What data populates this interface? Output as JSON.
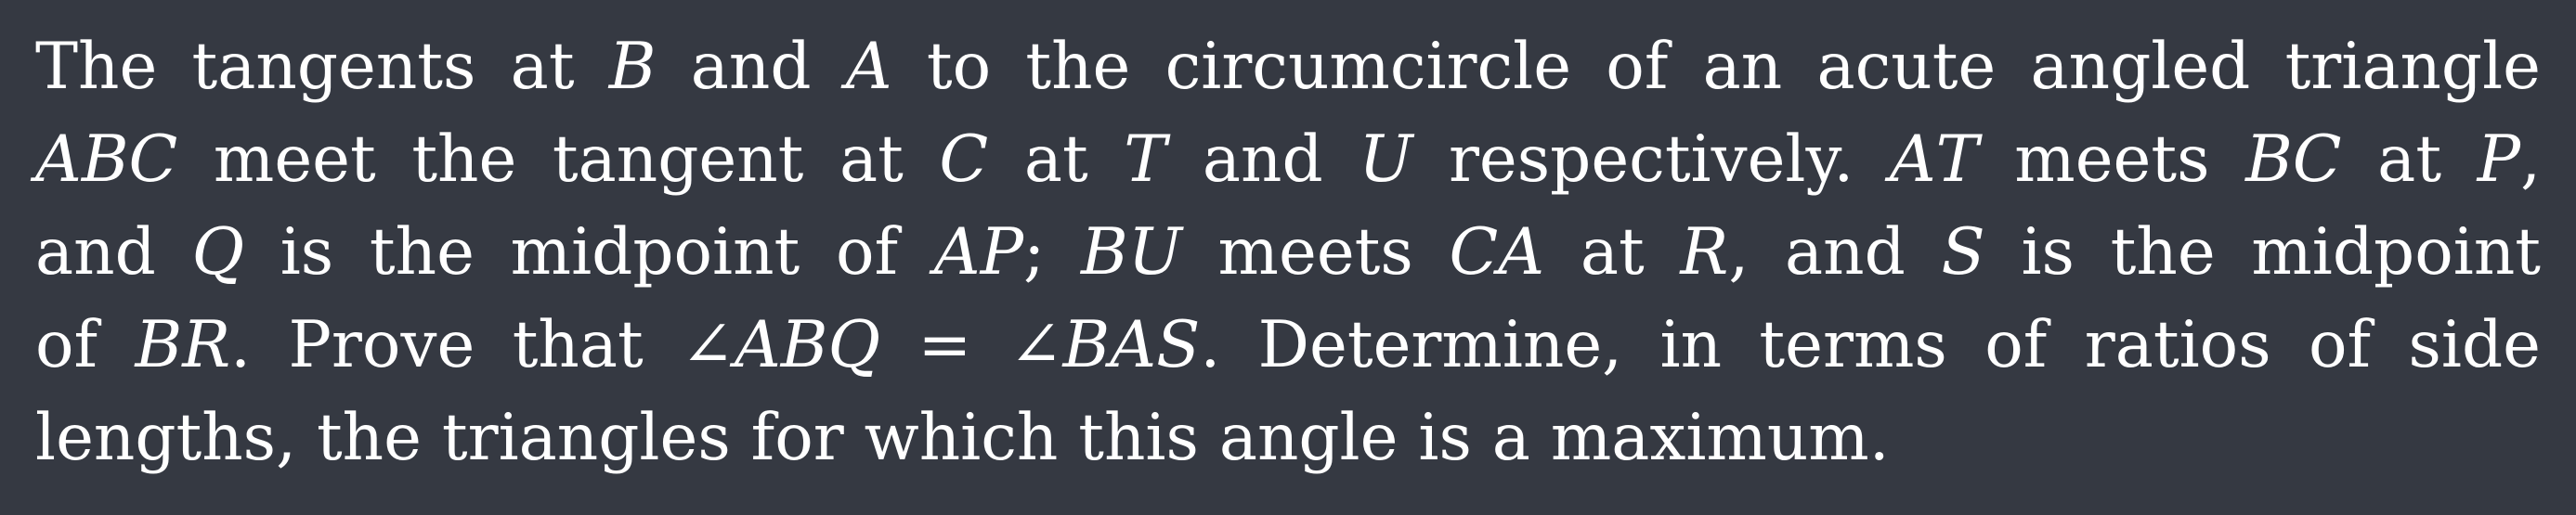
{
  "problem": {
    "lines": [
      "The tangents at 𝐵 and 𝐴 to the circumcircle of an acute angled triangle",
      "𝐴𝐵𝐶 meet the tangent at 𝐶 at 𝑇 and 𝑈 respectively. 𝐴𝑇 meets 𝐵𝐶 at 𝑃,",
      "and 𝑄 is the midpoint of 𝐴𝑃; 𝐵𝑈 meets 𝐶𝐴 at 𝑅, and 𝑆 is the midpoint",
      "of 𝐵𝑅. Prove that ∠𝐴𝐵𝑄 = ∠𝐵𝐴𝑆. Determine, in terms of ratios of side",
      "lengths, the triangles for which this angle is a maximum."
    ]
  }
}
